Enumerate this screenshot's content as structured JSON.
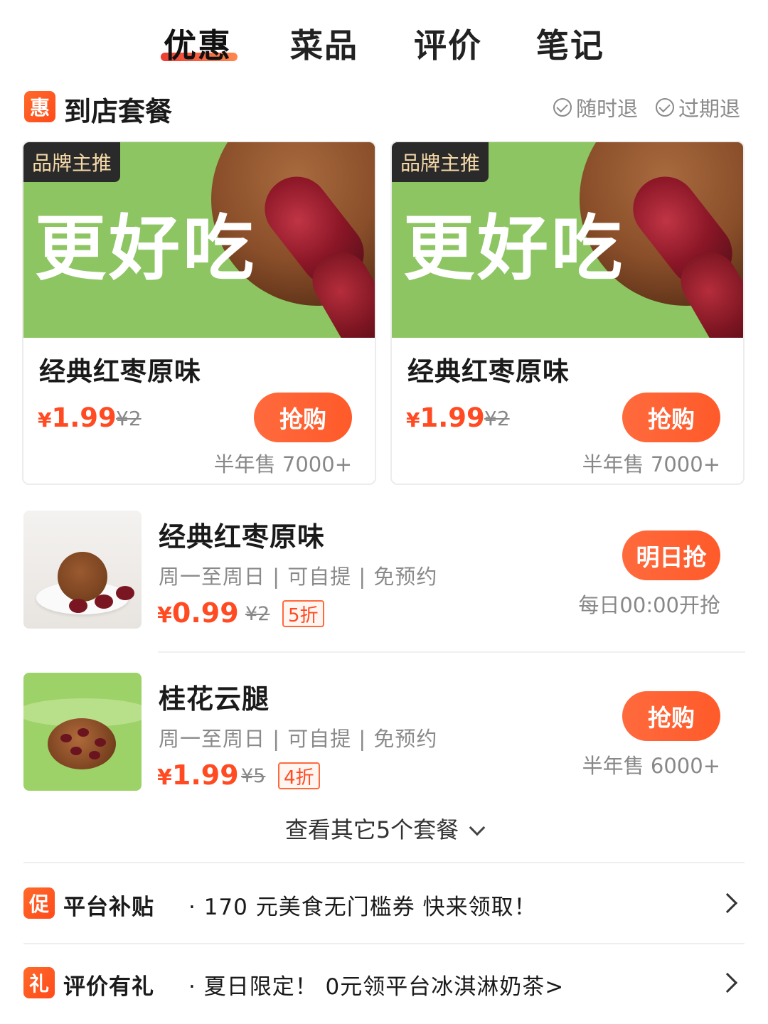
{
  "tabs": [
    {
      "label": "优惠",
      "active": true
    },
    {
      "label": "菜品",
      "active": false
    },
    {
      "label": "评价",
      "active": false
    },
    {
      "label": "笔记",
      "active": false
    }
  ],
  "section": {
    "badge": "惠",
    "title": "到店套餐",
    "guarantees": [
      "随时退",
      "过期退"
    ]
  },
  "featured": [
    {
      "brand_tag": "品牌主推",
      "banner_text": "更好吃",
      "name": "经典红枣原味",
      "currency": "¥",
      "price": "1.99",
      "original_price": "¥2",
      "button": "抢购",
      "sold": "半年售 7000+"
    },
    {
      "brand_tag": "品牌主推",
      "banner_text": "更好吃",
      "name": "经典红枣原味",
      "currency": "¥",
      "price": "1.99",
      "original_price": "¥2",
      "button": "抢购",
      "sold": "半年售 7000+"
    }
  ],
  "items": [
    {
      "name": "经典红枣原味",
      "desc": "周一至周日 | 可自提 | 免预约",
      "currency": "¥",
      "price": "0.99",
      "original_price": "¥2",
      "discount": "5折",
      "button": "明日抢",
      "note": "每日00:00开抢"
    },
    {
      "name": "桂花云腿",
      "desc": "周一至周日 | 可自提 | 免预约",
      "currency": "¥",
      "price": "1.99",
      "original_price": "¥5",
      "discount": "4折",
      "button": "抢购",
      "note": "半年售 6000+"
    }
  ],
  "more_packages": "查看其它5个套餐",
  "promos": [
    {
      "badge": "促",
      "title": "平台补贴",
      "text": "· 170 元美食无门槛券  快来领取！"
    },
    {
      "badge": "礼",
      "title": "评价有礼",
      "text": "· 夏日限定！ 0元领平台冰淇淋奶茶>"
    }
  ],
  "colors": {
    "accent": "#ff5a2a",
    "price": "#ff4a22",
    "banner_green": "#8cc562",
    "muted": "#8a8a8a"
  }
}
